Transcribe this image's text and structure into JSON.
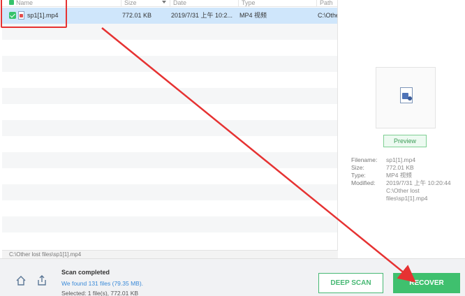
{
  "columns": {
    "name": "Name",
    "size": "Size",
    "date": "Date",
    "type": "Type",
    "path": "Path"
  },
  "rows": [
    {
      "name": "sp1[1].mp4",
      "size": "772.01 KB",
      "date": "2019/7/31 上午 10:2...",
      "type": "MP4 视频",
      "path": "C:\\Other"
    }
  ],
  "path_bar": "C:\\Other lost files\\sp1[1].mp4",
  "preview": {
    "button_label": "Preview",
    "labels": {
      "filename": "Filename:",
      "size": "Size:",
      "type": "Type:",
      "modified": "Modified:"
    },
    "values": {
      "filename": "sp1[1].mp4",
      "size": "772.01 KB",
      "type": "MP4 视频",
      "modified_1": "2019/7/31 上午 10:20:44",
      "modified_2": "C:\\Other lost",
      "modified_3": "files\\sp1[1].mp4"
    }
  },
  "status": {
    "title": "Scan completed",
    "found": "We found 131 files (79.35 MB).",
    "selected": "Selected: 1 file(s), 772.01 KB"
  },
  "buttons": {
    "deep_scan": "DEEP SCAN",
    "recover": "RECOVER"
  },
  "icons": {
    "home": "home-icon",
    "share": "share-icon",
    "file": "video-file-icon"
  },
  "colors": {
    "accent_green": "#3fc06e",
    "selected_row": "#cfe6fb",
    "annotation_red": "#e63232"
  }
}
